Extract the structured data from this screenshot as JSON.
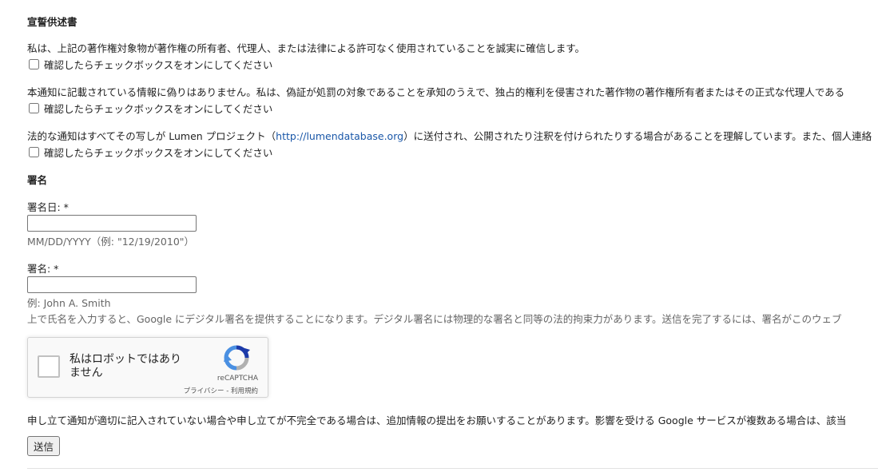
{
  "declaration": {
    "heading": "宣誓供述書",
    "statements": [
      {
        "text": "私は、上記の著作権対象物が著作権の所有者、代理人、または法律による許可なく使用されていることを誠実に確信します。",
        "checkbox_label": "確認したらチェックボックスをオンにしてください"
      },
      {
        "text": "本通知に記載されている情報に偽りはありません。私は、偽証が処罰の対象であることを承知のうえで、独占的権利を侵害された著作物の著作権所有者またはその正式な代理人である",
        "checkbox_label": "確認したらチェックボックスをオンにしてください"
      },
      {
        "text_before": "法的な通知はすべてその写しが Lumen プロジェクト（",
        "link": "http://lumendatabase.org",
        "text_after": "）に送付され、公開されたり注釈を付けられたりする場合があることを理解しています。また、個人連絡",
        "checkbox_label": "確認したらチェックボックスをオンにしてください"
      }
    ]
  },
  "signature": {
    "heading": "署名",
    "date_label": "署名日: *",
    "date_value": "",
    "date_hint": "MM/DD/YYYY（例: \"12/19/2010\"）",
    "name_label": "署名: *",
    "name_value": "",
    "name_hint": "例: John A. Smith",
    "digital_signature_note": "上で氏名を入力すると、Google にデジタル署名を提供することになります。デジタル署名には物理的な署名と同等の法的拘束力があります。送信を完了するには、署名がこのウェブ"
  },
  "recaptcha": {
    "label": "私はロボットではありません",
    "brand": "reCAPTCHA",
    "privacy_link": "プライバシー",
    "separator": " - ",
    "terms_link": "利用規約",
    "colors": {
      "arrow_blue": "#1c3aa9",
      "arrow_light": "#4a90e2",
      "arrow_gray": "#b0b0b0"
    }
  },
  "footer": {
    "note": "申し立て通知が適切に記入されていない場合や申し立てが不完全である場合は、追加情報の提出をお願いすることがあります。影響を受ける Google サービスが複数ある場合は、該当",
    "submit_label": "送信"
  }
}
